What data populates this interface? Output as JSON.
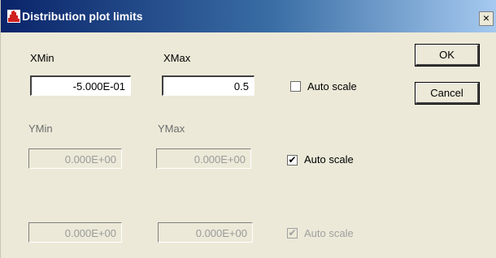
{
  "window": {
    "title": "Distribution plot limits",
    "close_glyph": "×"
  },
  "x": {
    "min_label": "XMin",
    "max_label": "XMax",
    "min_value": "-5.000E-01",
    "max_value": "0.5",
    "auto_label": "Auto scale",
    "auto_checked": false
  },
  "y": {
    "min_label": "YMin",
    "max_label": "YMax",
    "min_value": "0.000E+00",
    "max_value": "0.000E+00",
    "auto_label": "Auto scale",
    "auto_checked": true,
    "check_glyph": "✔"
  },
  "z": {
    "min_value": "0.000E+00",
    "max_value": "0.000E+00",
    "auto_label": "Auto scale",
    "auto_checked": true,
    "check_glyph": "✔"
  },
  "buttons": {
    "ok": "OK",
    "cancel": "Cancel"
  },
  "icons": {
    "app": "histogram-icon",
    "close": "close-icon"
  }
}
